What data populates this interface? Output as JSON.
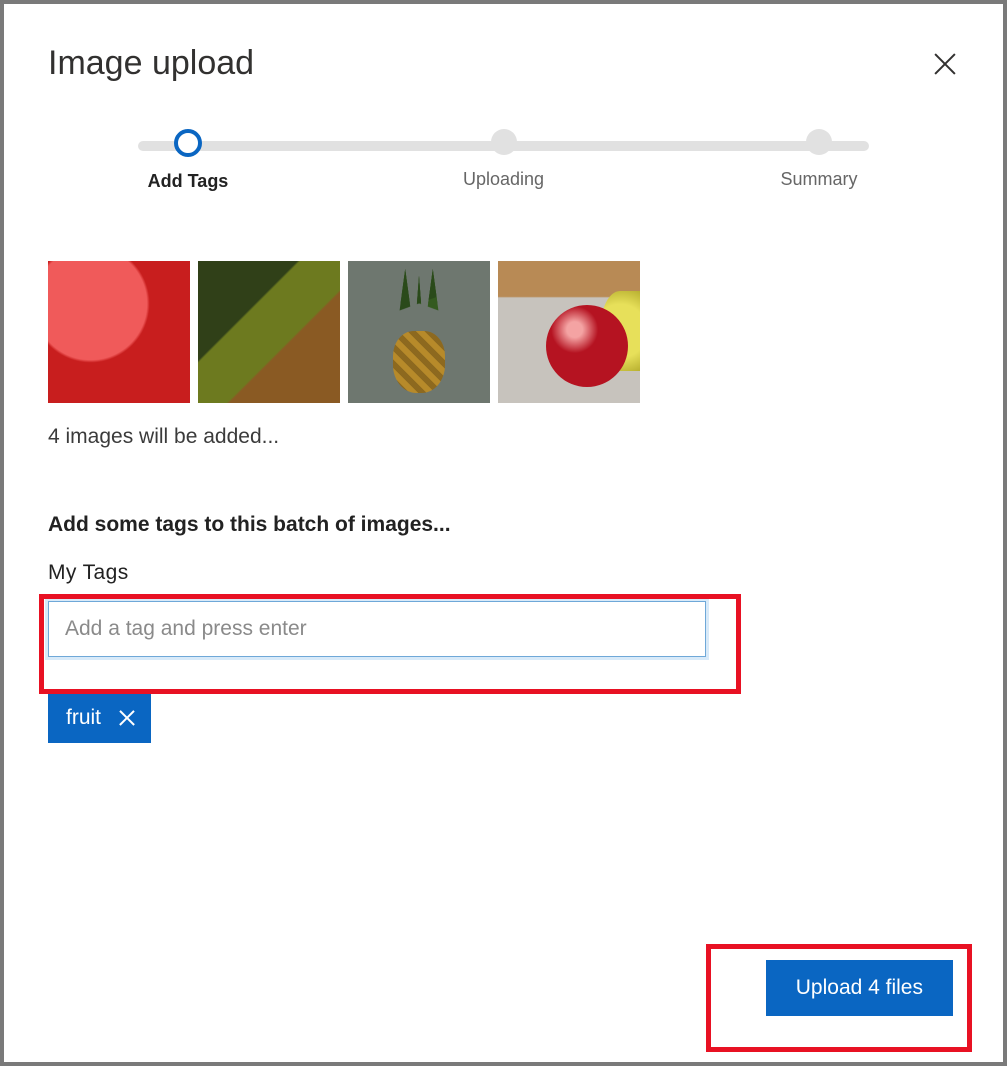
{
  "dialog": {
    "title": "Image upload"
  },
  "stepper": {
    "steps": [
      {
        "label": "Add Tags",
        "active": true
      },
      {
        "label": "Uploading",
        "active": false
      },
      {
        "label": "Summary",
        "active": false
      }
    ]
  },
  "thumbnails": {
    "count_text": "4 images will be added..."
  },
  "tags": {
    "prompt": "Add some tags to this batch of images...",
    "section_label": "My Tags",
    "input_placeholder": "Add a tag and press enter",
    "chips": [
      {
        "label": "fruit"
      }
    ]
  },
  "actions": {
    "upload_label": "Upload 4 files"
  }
}
